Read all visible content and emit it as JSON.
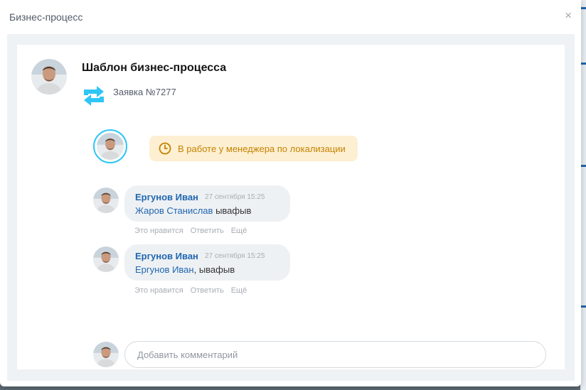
{
  "dialog": {
    "title": "Бизнес-процесс",
    "close_label": "×"
  },
  "process": {
    "title": "Шаблон бизнес-процесса",
    "subtitle": "Заявка №7277"
  },
  "status": {
    "text": "В работе у менеджера по локализации",
    "color": "#c48300"
  },
  "comments": [
    {
      "author": "Ергунов Иван",
      "time": "27 сентября 15:25",
      "mention": "Жаров Станислав",
      "text": " ывафыв"
    },
    {
      "author": "Ергунов Иван",
      "time": "27 сентября 15:25",
      "mention": "Ергунов Иван",
      "text": ", ывафыв"
    }
  ],
  "comment_actions": {
    "like": "Это нравится",
    "reply": "Ответить",
    "more": "Ещё"
  },
  "add_comment": {
    "placeholder": "Добавить комментарий"
  },
  "icons": {
    "close": "close-icon",
    "process": "repeat-arrows-icon",
    "status": "clock-icon",
    "avatar": "user-avatar-icon"
  },
  "colors": {
    "link": "#2067b0",
    "accent": "#2fc6f6",
    "status_bg": "#fdefd2"
  }
}
